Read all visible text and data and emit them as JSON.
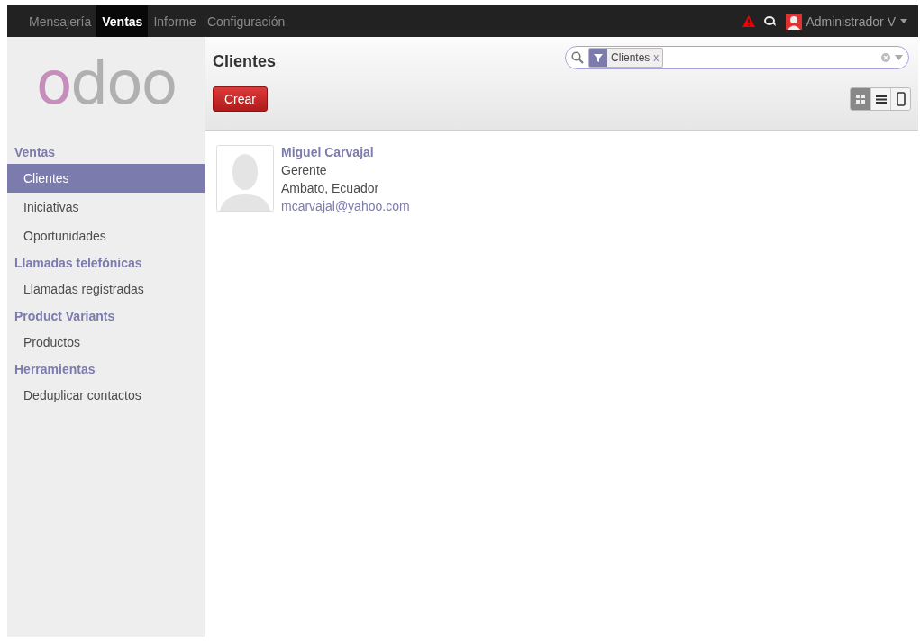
{
  "top_menu": [
    {
      "label": "Mensajería",
      "selected": false
    },
    {
      "label": "Ventas",
      "selected": true
    },
    {
      "label": "Informe",
      "selected": false
    },
    {
      "label": "Configuración",
      "selected": false
    }
  ],
  "user": {
    "name": "Administrador V"
  },
  "logo": "odoo",
  "sidebar": [
    {
      "heading": "Ventas",
      "items": [
        {
          "label": "Clientes",
          "selected": true
        },
        {
          "label": "Iniciativas",
          "selected": false
        },
        {
          "label": "Oportunidades",
          "selected": false
        }
      ]
    },
    {
      "heading": "Llamadas telefónicas",
      "items": [
        {
          "label": "Llamadas registradas",
          "selected": false
        }
      ]
    },
    {
      "heading": "Product Variants",
      "items": [
        {
          "label": "Productos",
          "selected": false
        }
      ]
    },
    {
      "heading": "Herramientas",
      "items": [
        {
          "label": "Deduplicar contactos",
          "selected": false
        }
      ]
    }
  ],
  "page_title": "Clientes",
  "search": {
    "facets": [
      {
        "label": "Clientes",
        "remove": "x"
      }
    ]
  },
  "create_button": "Crear",
  "views": [
    {
      "kind": "kanban",
      "selected": true
    },
    {
      "kind": "list",
      "selected": false
    },
    {
      "kind": "form",
      "selected": false
    }
  ],
  "cards": [
    {
      "name": "Miguel Carvajal",
      "function": "Gerente",
      "location": "Ambato, Ecuador",
      "email": "mcarvajal@yahoo.com"
    }
  ]
}
